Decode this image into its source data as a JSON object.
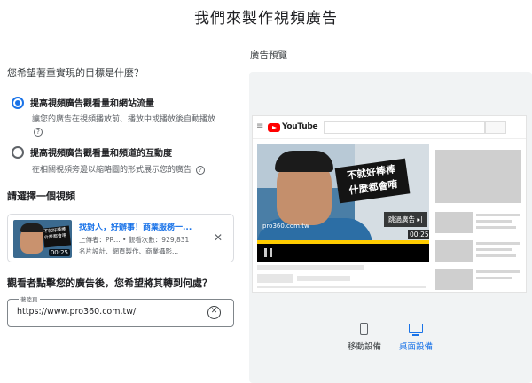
{
  "page": {
    "title": "我們來製作視頻廣告"
  },
  "goal": {
    "question": "您希望著重實現的目標是什麼？",
    "options": [
      {
        "label": "提高視頻廣告觀看量和網站流量",
        "description": "讓您的廣告在視頻播放前、播放中或播放後自動播放",
        "selected": true
      },
      {
        "label": "提高視頻廣告觀看量和頻道的互動度",
        "description": "在相關視頻旁邊以縮略圖的形式展示您的廣告",
        "selected": false
      }
    ]
  },
  "video_select": {
    "question": "請選擇一個視頻",
    "card": {
      "title": "找對人，好辦事！商業服務一...",
      "uploader_line": "上傳者：PR... • 觀看次數：929,831",
      "tags_line": "名片設計、網頁製作、商業攝影...",
      "duration": "00:25",
      "thumb_caption": "不就好棒棒 什麼都會唷"
    }
  },
  "destination": {
    "question": "觀看者點擊您的廣告後，您希望將其轉到何處？",
    "field_label": "著陸頁",
    "url_value": "https://www.pro360.com.tw/"
  },
  "preview": {
    "title": "廣告預覽",
    "yt_brand": "YouTube",
    "caption_line1": "不就好棒棒",
    "caption_line2": "什麼都會唷",
    "watermark": "pro360.com.tw",
    "skip_label": "跳過廣告 ▸|",
    "duration": "00:25",
    "devices": [
      {
        "label": "移動設備",
        "active": false
      },
      {
        "label": "桌面設備",
        "active": true
      }
    ]
  },
  "colors": {
    "accent": "#1a73e8",
    "text": "#202124",
    "muted": "#5f6368",
    "panel": "#f1f3f4",
    "youtube_red": "#ff0000"
  },
  "icons": [
    "help-circle-icon",
    "close-icon",
    "clear-circle-icon",
    "hamburger-menu-icon",
    "youtube-logo-icon",
    "pause-icon",
    "phone-icon",
    "monitor-icon"
  ]
}
